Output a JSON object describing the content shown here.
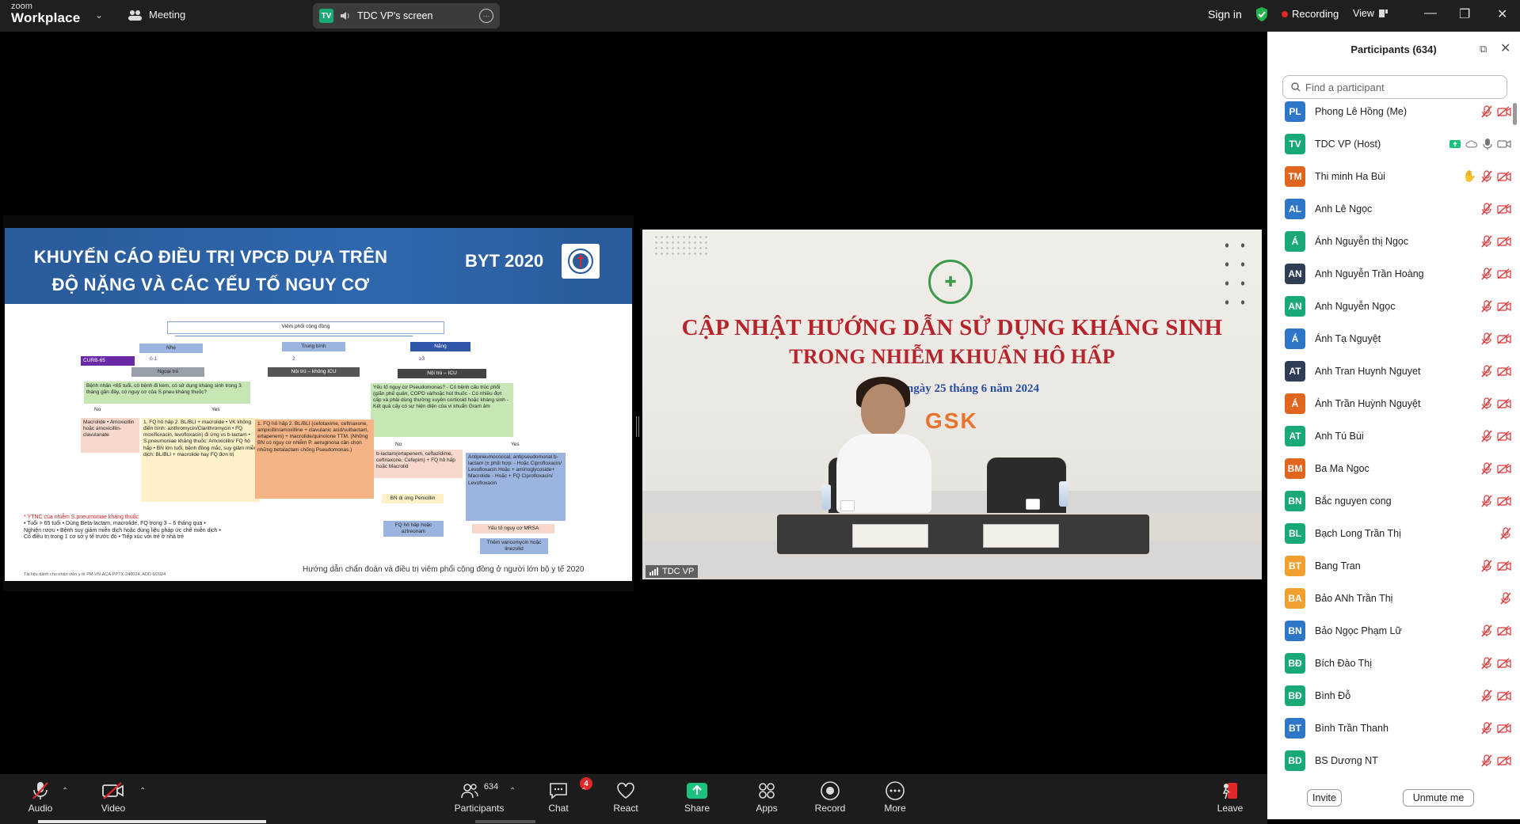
{
  "titlebar": {
    "logo_line1": "zoom",
    "logo_line2": "Workplace",
    "meeting_label": "Meeting",
    "share_avatar": "TV",
    "share_label": "TDC VP's screen",
    "signin_label": "Sign in",
    "recording_label": "Recording",
    "view_label": "View"
  },
  "slide": {
    "title_line1": "KHUYẾN CÁO ĐIỀU TRỊ VPCĐ DỰA TRÊN",
    "title_line2": "ĐỘ NẶNG VÀ CÁC YẾU TỐ NGUY CƠ",
    "badge": "BYT 2020",
    "root_node": "Viêm phổi cộng đồng",
    "level_mild": "Nhẹ",
    "level_mid": "Trung bình",
    "level_severe": "Nặng",
    "curb": "CURB-65",
    "score_mild": "0-1",
    "score_mid": "2",
    "score_severe": "≥3",
    "care_out": "Ngoại trú",
    "care_in": "Nội trú – không ICU",
    "care_icu": "Nội trú – ICU",
    "q_out": "Bệnh nhân <65 tuổi, có bệnh đi kèm, có sử dụng kháng sinh trong 3 tháng gần đây, có nguy cơ của S.pneu kháng thuốc?",
    "q_icu": "Yếu tố nguy cơ Pseudomonas? - Có bệnh cấu trúc phổi (giãn phế quản, COPD và/hoặc hút thuốc - Có nhiều đợt cấp và phải dùng thường xuyên corticoid hoặc kháng sinh - Kết quả cấy có sự hiện diện của vi khuẩn Gram âm",
    "no": "No",
    "yes": "Yes",
    "box_macrolide": "Macrolide • Amoxicillin hoặc amoxicillin-clavulanate",
    "box_fq": "1. FQ hô hấp 2. BL/BLI + macrolide • VK không điển hình: azithromycin/Clarithromycin • FQ moxifloxacin, levofloxacin) đi ứng vs b-lactam • S.pneumoniae kháng thuốc: Amoxicillin/ FQ hô hấp • BN lớn tuổi, bệnh đồng mắc, suy giảm miễn dịch: BL/BLI + macrolide hay FQ đơn trị",
    "box_inpatient": "1. FQ hô hấp 2. BL/BLI (cefotaxime, ceftriaxone, ampicillin/amoxilline + clavulanic acid/sulbactam, ertapenem) + macrolide/quinolone TTM. (Những BN có nguy cơ nhiễm P. aeruginosa cần chọn những betalactam chống Pseudomonas.)",
    "box_icu_no": "b-lactam(ertapenem, ceftazidime, ceftriaxone, Cefepim) + FQ hô hấp hoặc Macrolid",
    "box_icu_yes": "Antipneumococcal, antipseudomonal b-lactam (± phối hợp: - Hoặc Ciprofloxacin/ Levofloxacin Hoặc + aminoglycoside+ Macrolide - Hoặc + FQ Ciprofloxacin/ Levofloxacin",
    "box_penicillin": "BN dị ứng Penicillin",
    "box_aztreonam": "FQ hô hấp hoặc aztreonam",
    "box_mrsa": "Yếu tố nguy cơ MRSA",
    "box_vanco": "Thêm vancomycin hoặc linezolid",
    "ytnc_title": "* YTNC của nhiễm S.pneumoniae kháng thuốc",
    "ytnc_items": "• Tuổi > 65 tuổi • Dùng Beta-lactam, macrolide, FQ trong 3 – 6 tháng qua • Nghiện rượu • Bệnh suy giảm miễn dịch hoặc dùng liệu pháp ức chế miễn dịch • Có điều trị trong 1 cơ sở y tế trước đó • Tiếp xúc với trẻ ở nhà trẻ",
    "footer": "Hướng dẫn chẩn đoán và điều trị viêm phổi cộng đồng ở người lớn bộ y tế 2020",
    "footer_small": "Tài liệu dành cho nhân viên y tế PM-VN-ACA-PPTX-240024, ADD 6/2024"
  },
  "video": {
    "title_line1": "CẬP NHẬT HƯỚNG DẪN SỬ DỤNG KHÁNG SINH",
    "title_line2": "TRONG NHIỄM KHUẨN HÔ HẤP",
    "date": "Hà Nội, ngày 25 tháng 6 năm 2024",
    "sponsor": "GSK",
    "speaker_label": "TDC VP"
  },
  "participants": {
    "header": "Participants (634)",
    "search_placeholder": "Find a participant",
    "invite_label": "Invite",
    "unmute_label": "Unmute me",
    "list": [
      {
        "initials": "PL",
        "name": "Phong Lê Hồng (Me)",
        "color": "#2e77c6"
      },
      {
        "initials": "TV",
        "name": "TDC VP (Host)",
        "color": "#19a974"
      },
      {
        "initials": "TM",
        "name": "Thi minh Ha Bùi",
        "color": "#e0661f"
      },
      {
        "initials": "AL",
        "name": "Anh Lê Ngọc",
        "color": "#2e77c6"
      },
      {
        "initials": "Á",
        "name": "Ánh Nguyễn thị Ngọc",
        "color": "#19a974"
      },
      {
        "initials": "AN",
        "name": "Anh Nguyễn Trần Hoàng",
        "color": "#2f3e55"
      },
      {
        "initials": "AN",
        "name": "Anh Nguyễn Ngọc",
        "color": "#19a974"
      },
      {
        "initials": "Á",
        "name": "Ánh Tạ Nguyệt",
        "color": "#2e77c6"
      },
      {
        "initials": "AT",
        "name": "Anh Tran Huynh Nguyet",
        "color": "#2f3e55"
      },
      {
        "initials": "Á",
        "name": "Ánh Trần Huỳnh Nguyệt",
        "color": "#e0661f"
      },
      {
        "initials": "AT",
        "name": "Anh Tú Bùi",
        "color": "#19a974"
      },
      {
        "initials": "BM",
        "name": "Ba Ma Ngoc",
        "color": "#e0661f"
      },
      {
        "initials": "BN",
        "name": "Bắc nguyen cong",
        "color": "#19a974"
      },
      {
        "initials": "BL",
        "name": "Bạch Long Trần Thị",
        "color": "#19a974"
      },
      {
        "initials": "BT",
        "name": "Bang Tran",
        "color": "#f0a030"
      },
      {
        "initials": "BA",
        "name": "Bảo ANh Trần Thị",
        "color": "#f0a030"
      },
      {
        "initials": "BN",
        "name": "Bảo Ngọc Phạm Lữ",
        "color": "#2e77c6"
      },
      {
        "initials": "BĐ",
        "name": "Bích Đào Thị",
        "color": "#19a974"
      },
      {
        "initials": "BĐ",
        "name": "Bình Đỗ",
        "color": "#19a974"
      },
      {
        "initials": "BT",
        "name": "Bình Trần Thanh",
        "color": "#2e77c6"
      },
      {
        "initials": "BD",
        "name": "BS Dương NT",
        "color": "#19a974"
      }
    ]
  },
  "toolbar": {
    "audio_label": "Audio",
    "video_label": "Video",
    "participants_label": "Participants",
    "participants_count": "634",
    "chat_label": "Chat",
    "chat_badge": "4",
    "react_label": "React",
    "share_label": "Share",
    "apps_label": "Apps",
    "record_label": "Record",
    "more_label": "More",
    "leave_label": "Leave"
  },
  "colors": {
    "titlebar_bg": "#1f1f1f",
    "toolbar_bg": "#1c1c1c",
    "share_green": "#19a974",
    "danger_red": "#e02828",
    "slide_header_blue": "#2f67ad",
    "video_title_red": "#b5242a"
  },
  "icons": [
    "chevron-down-icon",
    "meeting-icon",
    "speaker-icon",
    "more-icon",
    "shield-check-icon",
    "view-icon",
    "minimize-icon",
    "maximize-icon",
    "close-icon",
    "search-icon",
    "popout-icon",
    "mic-muted-icon",
    "video-muted-icon",
    "raise-hand-icon",
    "share-screen-icon",
    "participants-icon",
    "chat-icon",
    "heart-icon",
    "share-up-icon",
    "apps-icon",
    "record-icon",
    "more-dots-icon",
    "leave-icon"
  ]
}
